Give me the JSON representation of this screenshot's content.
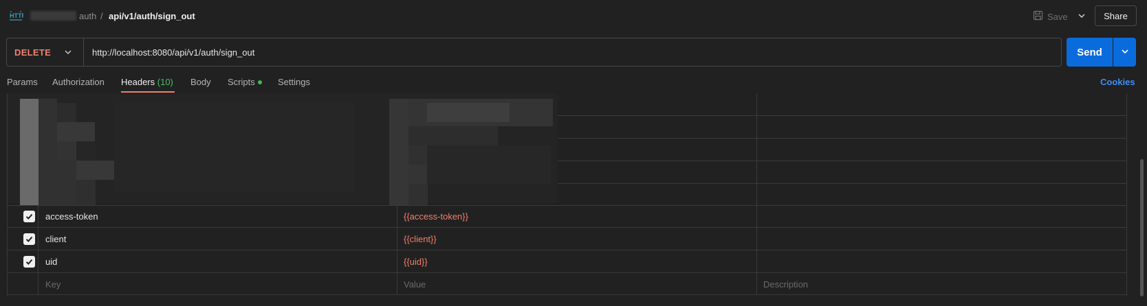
{
  "breadcrumb": {
    "parent": "auth",
    "separator": "/",
    "current": "api/v1/auth/sign_out"
  },
  "toolbar": {
    "save_label": "Save",
    "share_label": "Share"
  },
  "request": {
    "method": "DELETE",
    "url": "http://localhost:8080/api/v1/auth/sign_out",
    "send_label": "Send"
  },
  "tabs": [
    {
      "label": "Params"
    },
    {
      "label": "Authorization"
    },
    {
      "label": "Headers",
      "count": "(10)",
      "active": true
    },
    {
      "label": "Body"
    },
    {
      "label": "Scripts",
      "indicator": true
    },
    {
      "label": "Settings"
    }
  ],
  "cookies_label": "Cookies",
  "headers": {
    "rows": [
      {
        "key": "access-token",
        "value": "{{access-token}}",
        "checked": true
      },
      {
        "key": "client",
        "value": "{{client}}",
        "checked": true
      },
      {
        "key": "uid",
        "value": "{{uid}}",
        "checked": true
      }
    ],
    "placeholder": {
      "key": "Key",
      "value": "Value",
      "description": "Description"
    }
  },
  "colors": {
    "method": "#f0806d",
    "variable": "#f0806d",
    "send": "#0a6cdc",
    "cookies": "#3d8ff5",
    "header_count": "#4cbf6c",
    "active_tab_underline": "#f0806d"
  },
  "icons": {
    "app": "http-icon",
    "save": "save-icon",
    "chevron": "chevron-down-icon",
    "check": "check-icon"
  }
}
